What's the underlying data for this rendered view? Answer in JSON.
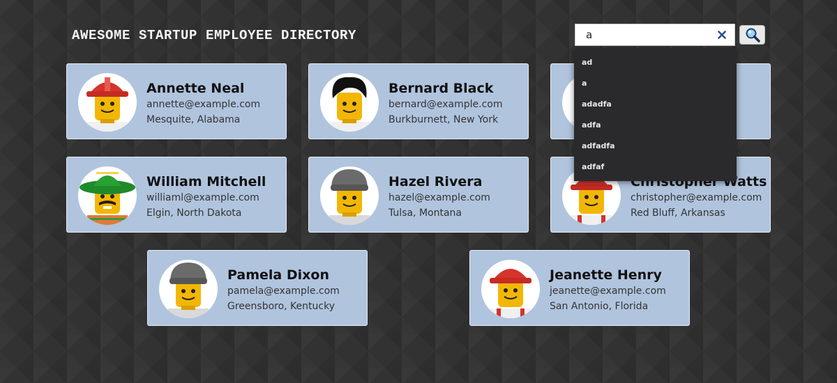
{
  "header": {
    "title": "AWESOME STARTUP EMPLOYEE DIRECTORY"
  },
  "search": {
    "value": "a",
    "clear_icon": "close-icon",
    "button_icon": "magnifier-icon",
    "suggestions": [
      "ad",
      "a",
      "adadfa",
      "adfa",
      "adfadfa",
      "adfaf"
    ]
  },
  "colors": {
    "card_bg": "#b0c4de",
    "dropdown_bg": "#2a2a2c",
    "page_bg": "#323232"
  },
  "employees": [
    {
      "name": "Annette Neal",
      "email": "annette@example.com",
      "location": "Mesquite, Alabama",
      "avatar": "lego-hardhat-red"
    },
    {
      "name": "Bernard Black",
      "email": "bernard@example.com",
      "location": "Burkburnett, New York",
      "avatar": "lego-black-hair"
    },
    {
      "name": "",
      "email": "",
      "location": "",
      "avatar": "lego-dark-hair"
    },
    {
      "name": "William Mitchell",
      "email": "williaml@example.com",
      "location": "Elgin, North Dakota",
      "avatar": "lego-sombrero-mustache"
    },
    {
      "name": "Hazel Rivera",
      "email": "hazel@example.com",
      "location": "Tulsa, Montana",
      "avatar": "lego-gray-beanie"
    },
    {
      "name": "Christopher Watts",
      "email": "christopher@example.com",
      "location": "Red Bluff, Arkansas",
      "avatar": "lego-hardhat-red"
    },
    {
      "name": "Pamela Dixon",
      "email": "pamela@example.com",
      "location": "Greensboro, Kentucky",
      "avatar": "lego-gray-beanie"
    },
    {
      "name": "Jeanette Henry",
      "email": "jeanette@example.com",
      "location": "San Antonio, Florida",
      "avatar": "lego-hardhat-red"
    }
  ]
}
